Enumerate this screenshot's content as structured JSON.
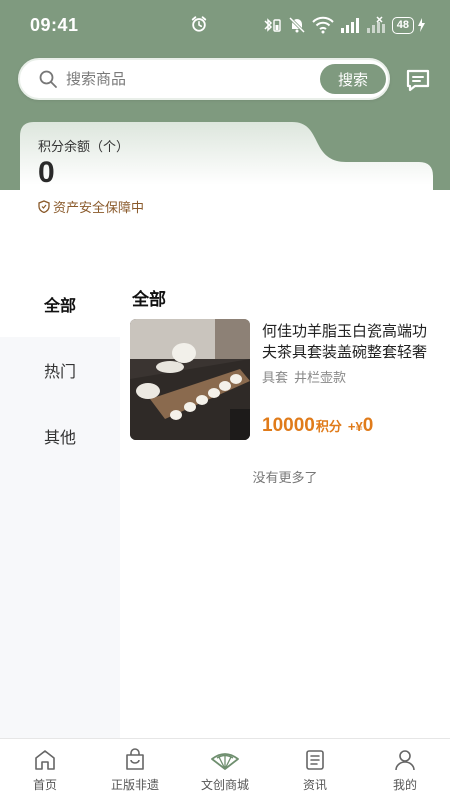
{
  "status_bar": {
    "time": "09:41",
    "battery": "48"
  },
  "search": {
    "placeholder": "搜索商品",
    "button_label": "搜索"
  },
  "points_card": {
    "label": "积分余额（个）",
    "value": "0",
    "safety_note": "资产安全保障中"
  },
  "categories": [
    {
      "label": "全部",
      "active": true
    },
    {
      "label": "热门",
      "active": false
    },
    {
      "label": "其他",
      "active": false
    }
  ],
  "main": {
    "section_title": "全部",
    "products": [
      {
        "title": "何佳功羊脂玉白瓷高端功夫茶具套装盖碗整套轻奢",
        "tags": [
          "具套",
          "井栏壶款"
        ],
        "price_points": "10000",
        "points_unit": "积分",
        "plus": "+¥",
        "price_cash": "0"
      }
    ],
    "no_more_text": "没有更多了"
  },
  "tabbar": {
    "items": [
      {
        "label": "首页",
        "icon": "home-icon"
      },
      {
        "label": "正版非遗",
        "icon": "shopping-bag-icon"
      },
      {
        "label": "文创商城",
        "icon": "fan-icon"
      },
      {
        "label": "资讯",
        "icon": "news-list-icon"
      },
      {
        "label": "我的",
        "icon": "user-icon"
      }
    ]
  },
  "colors": {
    "brand_green": "#7f9a7f",
    "price_orange": "#e07b1a",
    "safety_brown": "#8a5a2b"
  }
}
